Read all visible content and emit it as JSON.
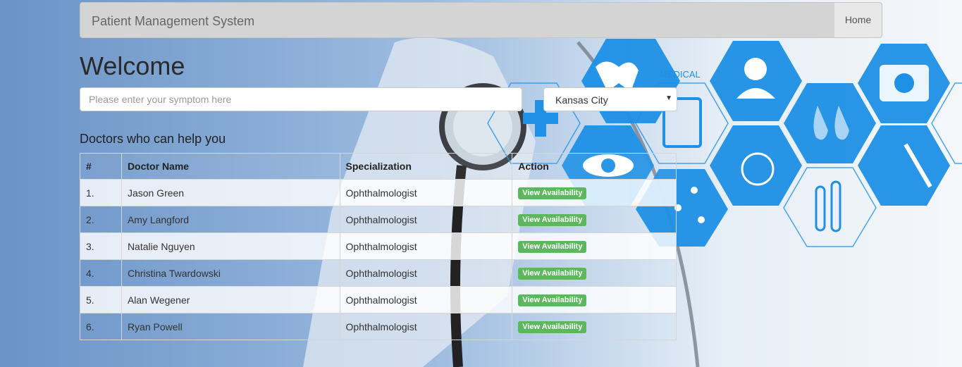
{
  "navbar": {
    "brand": "Patient Management System",
    "home": "Home"
  },
  "welcome": "Welcome",
  "search": {
    "placeholder": "Please enter your symptom here",
    "value": ""
  },
  "city_select": {
    "selected": "Kansas City"
  },
  "section_title": "Doctors who can help you",
  "table": {
    "headers": [
      "#",
      "Doctor Name",
      "Specialization",
      "Action"
    ],
    "rows": [
      {
        "num": "1.",
        "name": "Jason Green",
        "spec": "Ophthalmologist",
        "action": "View Availability"
      },
      {
        "num": "2.",
        "name": "Amy Langford",
        "spec": "Ophthalmologist",
        "action": "View Availability"
      },
      {
        "num": "3.",
        "name": "Natalie Nguyen",
        "spec": "Ophthalmologist",
        "action": "View Availability"
      },
      {
        "num": "4.",
        "name": "Christina Twardowski",
        "spec": "Ophthalmologist",
        "action": "View Availability"
      },
      {
        "num": "5.",
        "name": "Alan Wegener",
        "spec": "Ophthalmologist",
        "action": "View Availability"
      },
      {
        "num": "6.",
        "name": "Ryan Powell",
        "spec": "Ophthalmologist",
        "action": "View Availability"
      }
    ]
  },
  "background": {
    "hex_labels": [
      "MEDICAL",
      "MEDICAL"
    ],
    "accent": "#1e90e6",
    "button_green": "#5cb85c"
  }
}
